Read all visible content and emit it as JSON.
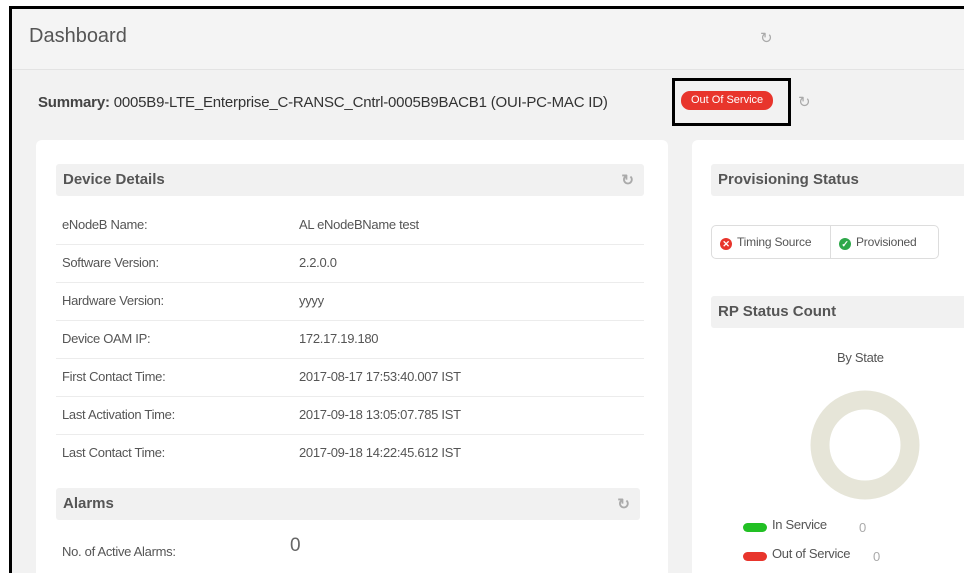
{
  "header": {
    "title": "Dashboard"
  },
  "summary": {
    "label": "Summary:",
    "device_id": "0005B9-LTE_Enterprise_C-RANSC_Cntrl-0005B9BACB1 (OUI-PC-MAC ID)",
    "status": "Out Of Service"
  },
  "device_details": {
    "title": "Device Details",
    "rows": [
      {
        "label": "eNodeB Name:",
        "value": "AL eNodeBName test"
      },
      {
        "label": "Software Version:",
        "value": "2.2.0.0"
      },
      {
        "label": "Hardware Version:",
        "value": "yyyy"
      },
      {
        "label": "Device OAM IP:",
        "value": "172.17.19.180"
      },
      {
        "label": "First Contact Time:",
        "value": "2017-08-17 17:53:40.007 IST"
      },
      {
        "label": "Last Activation Time:",
        "value": "2017-09-18 13:05:07.785 IST"
      },
      {
        "label": "Last Contact Time:",
        "value": "2017-09-18 14:22:45.612 IST"
      }
    ]
  },
  "alarms": {
    "title": "Alarms",
    "active_label": "No. of Active Alarms:",
    "active_count": "0"
  },
  "provisioning": {
    "title": "Provisioning Status",
    "items": [
      {
        "label": "Timing Source",
        "state": "error"
      },
      {
        "label": "Provisioned",
        "state": "ok"
      }
    ]
  },
  "rp_status": {
    "title": "RP Status Count",
    "chart_title": "By State",
    "legend": [
      {
        "label": "In Service",
        "count": "0",
        "color": "#22c024"
      },
      {
        "label": "Out of Service",
        "count": "0",
        "color": "#e8352c"
      }
    ],
    "ring_color": "#e6e5d8"
  },
  "chart_data": {
    "type": "pie",
    "title": "By State",
    "categories": [
      "In Service",
      "Out of Service"
    ],
    "values": [
      0,
      0
    ]
  },
  "colors": {
    "accent_red": "#e8352c",
    "ok_green": "#2ea84a",
    "background": "#f2f2f2"
  }
}
